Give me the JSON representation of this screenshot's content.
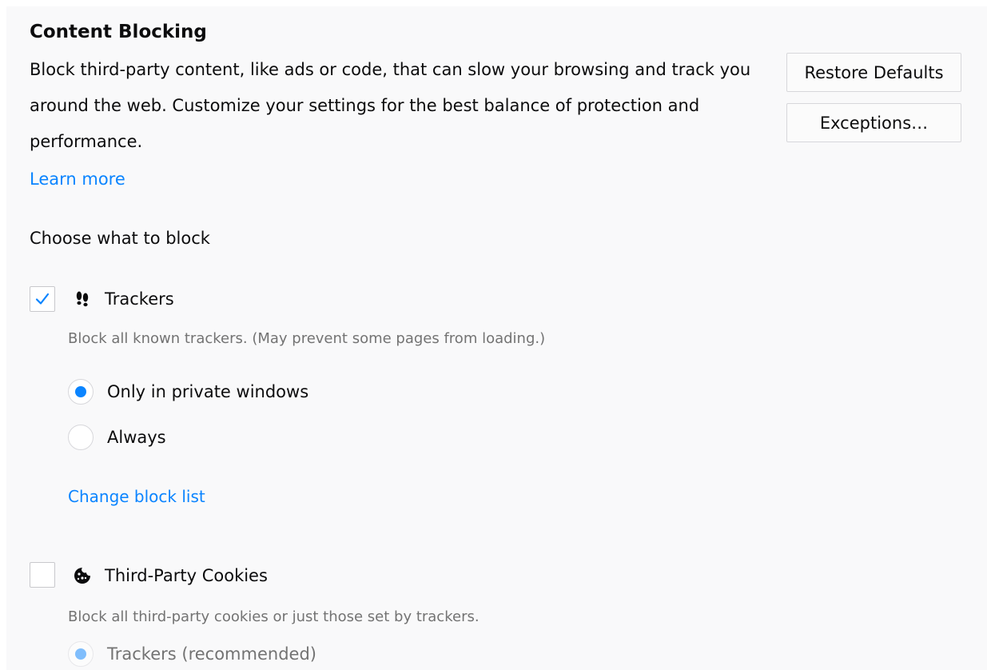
{
  "section": {
    "title": "Content Blocking",
    "description": "Block third-party content, like ads or code, that can slow your browsing and track you around the web. Customize your settings for the best balance of protection and performance.",
    "learn_more": "Learn more",
    "restore_defaults": "Restore Defaults",
    "exceptions": "Exceptions…"
  },
  "choose_label": "Choose what to block",
  "trackers": {
    "label": "Trackers",
    "checked": true,
    "icon": "footprints-icon",
    "description": "Block all known trackers. (May prevent some pages from loading.)",
    "options": [
      {
        "label": "Only in private windows",
        "selected": true
      },
      {
        "label": "Always",
        "selected": false
      }
    ],
    "change_block_list": "Change block list"
  },
  "cookies": {
    "label": "Third-Party Cookies",
    "checked": false,
    "icon": "cookie-icon",
    "description": "Block all third-party cookies or just those set by trackers.",
    "options": [
      {
        "label": "Trackers (recommended)",
        "selected": true,
        "disabled": true
      }
    ]
  },
  "colors": {
    "accent": "#0a84ff",
    "muted_text": "#737373",
    "panel_bg": "#f9f9fa"
  }
}
